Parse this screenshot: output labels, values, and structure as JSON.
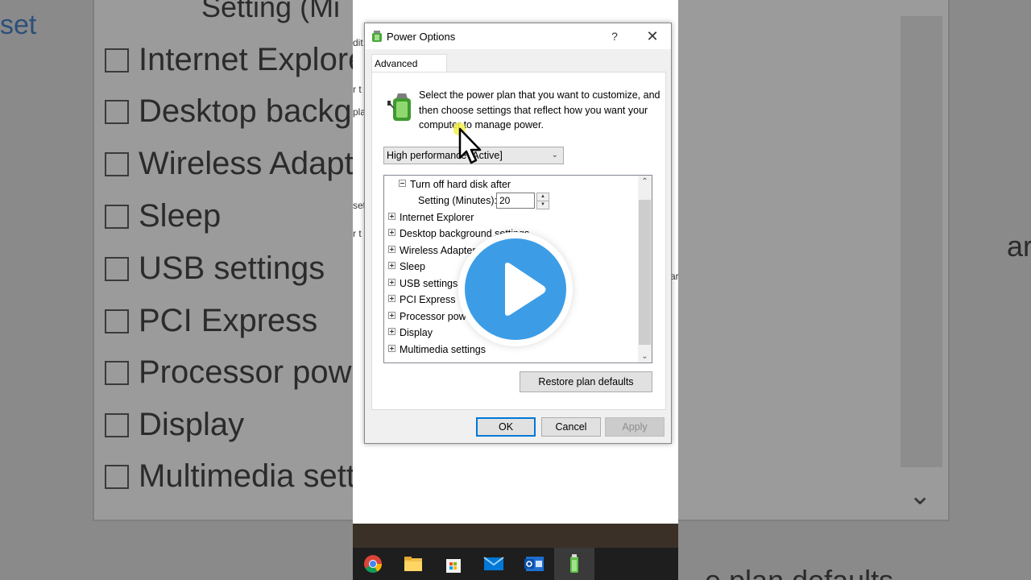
{
  "dialog": {
    "title": "Power Options",
    "help_label": "?",
    "close_label": "✕",
    "tab_label": "Advanced settings",
    "description": "Select the power plan that you want to customize, and then choose settings that reflect how you want your computer to manage power.",
    "plan_selected": "High performance [Active]",
    "tree": {
      "expanded_item": "Turn off hard disk after",
      "setting_label": "Setting (Minutes):",
      "setting_value": "20",
      "items": [
        "Internet Explorer",
        "Desktop background settings",
        "Wireless Adapter Settings",
        "Sleep",
        "USB settings",
        "PCI Express",
        "Processor power management",
        "Display",
        "Multimedia settings"
      ]
    },
    "restore_label": "Restore plan defaults",
    "ok_label": "OK",
    "cancel_label": "Cancel",
    "apply_label": "Apply"
  },
  "background": {
    "title_fragment": "Setting (Mi",
    "left_fragment": "set",
    "items": [
      "Internet Explorer",
      "Desktop backgr",
      "Wireless Adapte",
      "Sleep",
      "USB settings",
      "PCI Express",
      "Processor powe",
      "Display",
      "Multimedia setti"
    ],
    "right_fragment": "ar",
    "bottom_fragment": "e plan defaults"
  },
  "fragments": {
    "a": "dit",
    "b": "r t",
    "c": "pla",
    "d": "set",
    "e": "r t",
    "f": "ar"
  },
  "taskbar": {
    "icons": [
      "chrome-icon",
      "file-explorer-icon",
      "store-icon",
      "mail-icon",
      "outlook-icon",
      "power-options-icon"
    ]
  },
  "overlay": {
    "icon": "play-icon",
    "accent": "#3c9de6"
  }
}
